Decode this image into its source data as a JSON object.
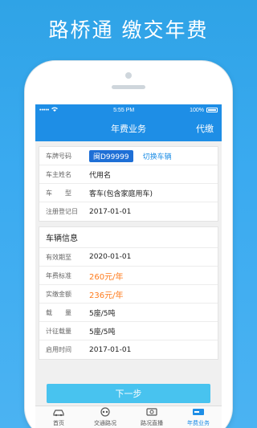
{
  "headline": "路桥通 缴交年费",
  "status_bar": {
    "carrier": "•••••",
    "time": "5:55 PM",
    "battery": "100%"
  },
  "nav": {
    "title": "年费业务",
    "action": "代缴"
  },
  "vehicle": {
    "plate_label": "车牌号码",
    "plate_value": "闽D99999",
    "switch_label": "切换车辆",
    "owner_label": "车主姓名",
    "owner_value": "代用名",
    "type_label": "车　　型",
    "type_value": "客车(包含家庭用车)",
    "reg_label": "注册登记日",
    "reg_value": "2017-01-01"
  },
  "info": {
    "section_title": "车辆信息",
    "valid_label": "有效期至",
    "valid_value": "2020-01-01",
    "fee_label": "年费标准",
    "fee_value": "260元/年",
    "paid_label": "实缴金额",
    "paid_value": "236元/年",
    "load_label": "载　　量",
    "load_value": "5座/5吨",
    "charge_load_label": "计征载量",
    "charge_load_value": "5座/5吨",
    "start_label": "启用时间",
    "start_value": "2017-01-01"
  },
  "next_button": "下一步",
  "tabs": [
    {
      "label": "首页",
      "icon": "car-home-icon"
    },
    {
      "label": "交通路况",
      "icon": "traffic-icon"
    },
    {
      "label": "路况直播",
      "icon": "camera-live-icon"
    },
    {
      "label": "年费业务",
      "icon": "card-fee-icon"
    }
  ],
  "colors": {
    "accent": "#1e8ee6",
    "price": "#ff7b1c",
    "plate": "#1e6fd6",
    "button": "#48c3ef"
  }
}
